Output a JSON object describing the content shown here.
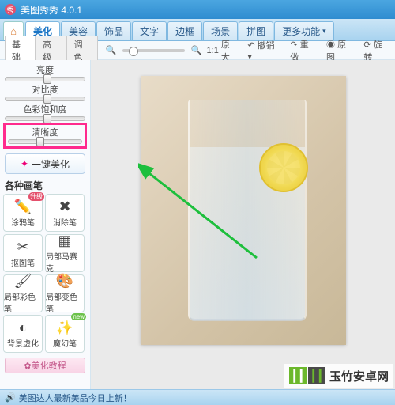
{
  "title": "美图秀秀 4.0.1",
  "main_tabs": [
    "美化",
    "美容",
    "饰品",
    "文字",
    "边框",
    "场景",
    "拼图",
    "更多功能"
  ],
  "active_main_tab": 0,
  "sub_tabs": [
    "基础",
    "高级",
    "调色"
  ],
  "active_sub_tab": 0,
  "zoom": {
    "ratio": "1:1",
    "label": "原大"
  },
  "tools": {
    "undo": "撤销",
    "redo": "重做",
    "original": "原图",
    "rotate": "旋转"
  },
  "sliders": [
    {
      "label": "亮度",
      "value": 50
    },
    {
      "label": "对比度",
      "value": 50
    },
    {
      "label": "色彩饱和度",
      "value": 50
    },
    {
      "label": "清晰度",
      "value": 40,
      "highlighted": true
    }
  ],
  "one_click": "一键美化",
  "brush_section": "各种画笔",
  "brushes": [
    {
      "label": "涂鸦笔",
      "icon": "✏️",
      "badge": "升级"
    },
    {
      "label": "消除笔",
      "icon": "✖"
    },
    {
      "label": "抠图笔",
      "icon": "✂"
    },
    {
      "label": "局部马赛克",
      "icon": "▦"
    },
    {
      "label": "局部彩色笔",
      "icon": "🖌"
    },
    {
      "label": "局部变色笔",
      "icon": "🎨"
    },
    {
      "label": "背景虚化",
      "icon": "◐"
    },
    {
      "label": "魔幻笔",
      "icon": "✨",
      "badge": "new"
    }
  ],
  "tutorial": "美化教程",
  "status": "美图达人最新美品今日上新！",
  "watermark": "玉竹安卓网"
}
